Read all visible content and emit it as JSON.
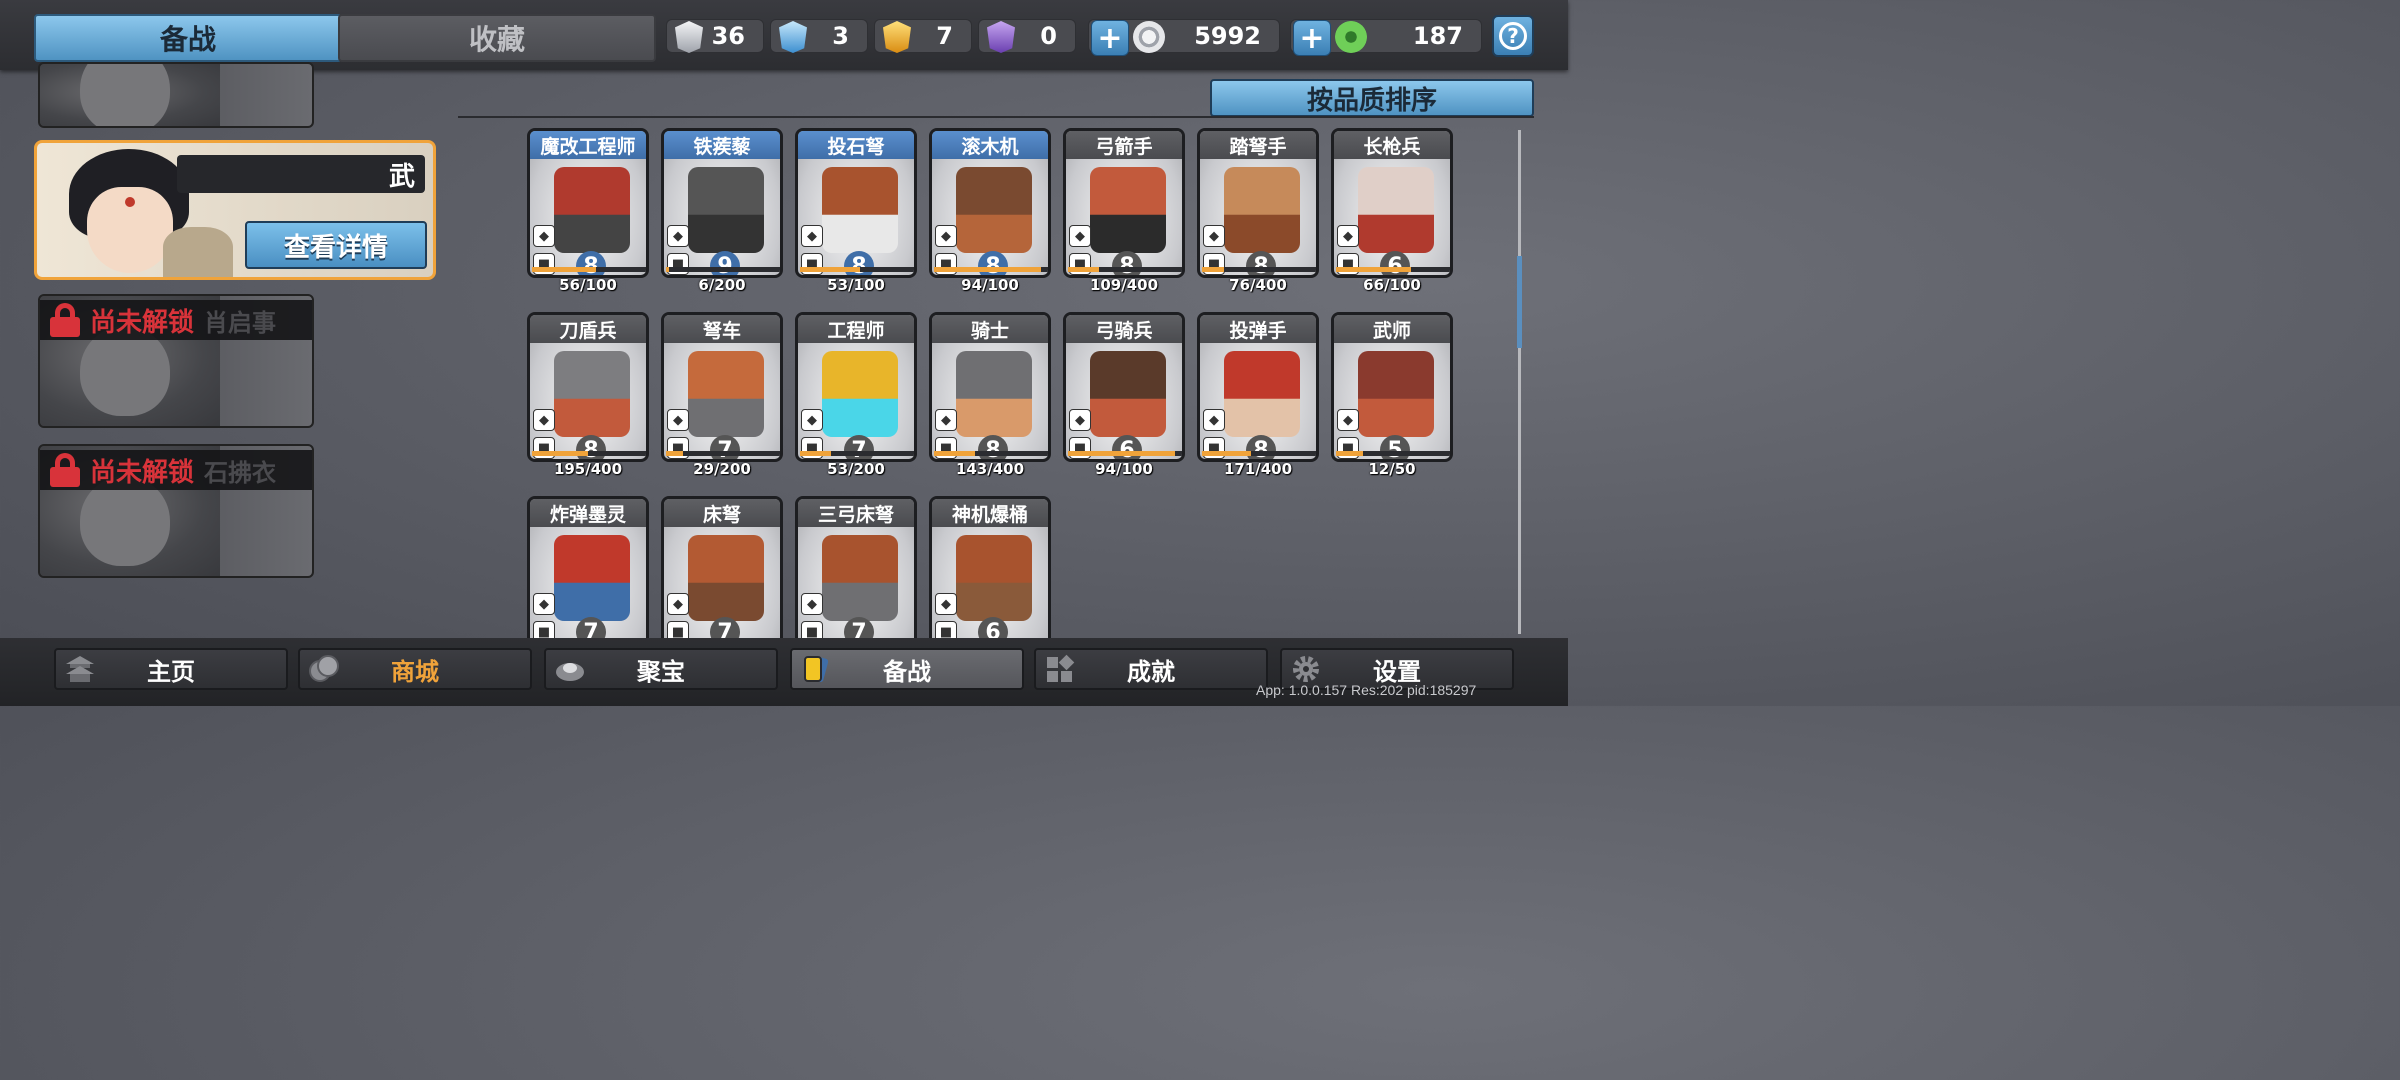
{
  "tabs": {
    "prep": "备战",
    "collection": "收藏"
  },
  "resources": [
    {
      "icon": "silver-gem-icon",
      "value": "36",
      "color": "#c9ccd2"
    },
    {
      "icon": "blue-gem-icon",
      "value": "3",
      "color": "#6fb6e8"
    },
    {
      "icon": "gold-gem-icon",
      "value": "7",
      "color": "#f2b31f"
    },
    {
      "icon": "purple-gem-icon",
      "value": "0",
      "color": "#8a5fc6"
    },
    {
      "icon": "silver-coin-icon",
      "value": "5992",
      "color": "#c9ccd2"
    },
    {
      "icon": "jade-coin-icon",
      "value": "187",
      "color": "#5cb84a"
    }
  ],
  "help": "?",
  "heroes": {
    "selected": {
      "name": "武",
      "detail_label": "查看详情"
    },
    "locked": [
      {
        "lock_text": "尚未解锁",
        "name": "肖启事"
      },
      {
        "lock_text": "尚未解锁",
        "name": "石拂衣"
      }
    ]
  },
  "sort_label": "按品质排序",
  "units": [
    {
      "name": "魔改工程师",
      "level": "8",
      "count": "56/100",
      "progress": 0.56,
      "blue": true
    },
    {
      "name": "铁蒺藜",
      "level": "9",
      "count": "6/200",
      "progress": 0.03,
      "blue": true
    },
    {
      "name": "投石弩",
      "level": "8",
      "count": "53/100",
      "progress": 0.53,
      "blue": true
    },
    {
      "name": "滚木机",
      "level": "8",
      "count": "94/100",
      "progress": 0.94,
      "blue": true
    },
    {
      "name": "弓箭手",
      "level": "8",
      "count": "109/400",
      "progress": 0.27,
      "blue": false
    },
    {
      "name": "踏弩手",
      "level": "8",
      "count": "76/400",
      "progress": 0.19,
      "blue": false
    },
    {
      "name": "长枪兵",
      "level": "6",
      "count": "66/100",
      "progress": 0.66,
      "blue": false
    },
    {
      "name": "刀盾兵",
      "level": "8",
      "count": "195/400",
      "progress": 0.49,
      "blue": false
    },
    {
      "name": "弩车",
      "level": "7",
      "count": "29/200",
      "progress": 0.15,
      "blue": false
    },
    {
      "name": "工程师",
      "level": "7",
      "count": "53/200",
      "progress": 0.27,
      "blue": false
    },
    {
      "name": "骑士",
      "level": "8",
      "count": "143/400",
      "progress": 0.36,
      "blue": false
    },
    {
      "name": "弓骑兵",
      "level": "6",
      "count": "94/100",
      "progress": 0.94,
      "blue": false
    },
    {
      "name": "投弹手",
      "level": "8",
      "count": "171/400",
      "progress": 0.43,
      "blue": false
    },
    {
      "name": "武师",
      "level": "5",
      "count": "12/50",
      "progress": 0.24,
      "blue": false
    },
    {
      "name": "炸弹墨灵",
      "level": "7",
      "count": "",
      "progress": 0,
      "blue": false
    },
    {
      "name": "床弩",
      "level": "7",
      "count": "",
      "progress": 0,
      "blue": false
    },
    {
      "name": "三弓床弩",
      "level": "7",
      "count": "",
      "progress": 0,
      "blue": false
    },
    {
      "name": "神机爆桶",
      "level": "6",
      "count": "",
      "progress": 0,
      "blue": false
    }
  ],
  "nav": [
    {
      "label": "主页",
      "icon": "home-pagoda-icon"
    },
    {
      "label": "商城",
      "icon": "coins-icon"
    },
    {
      "label": "聚宝",
      "icon": "treasure-bowl-icon"
    },
    {
      "label": "备战",
      "icon": "card-icon"
    },
    {
      "label": "成就",
      "icon": "achievement-grid-icon"
    },
    {
      "label": "设置",
      "icon": "gear-icon"
    }
  ],
  "version": "App: 1.0.0.157 Res:202 pid:185297"
}
